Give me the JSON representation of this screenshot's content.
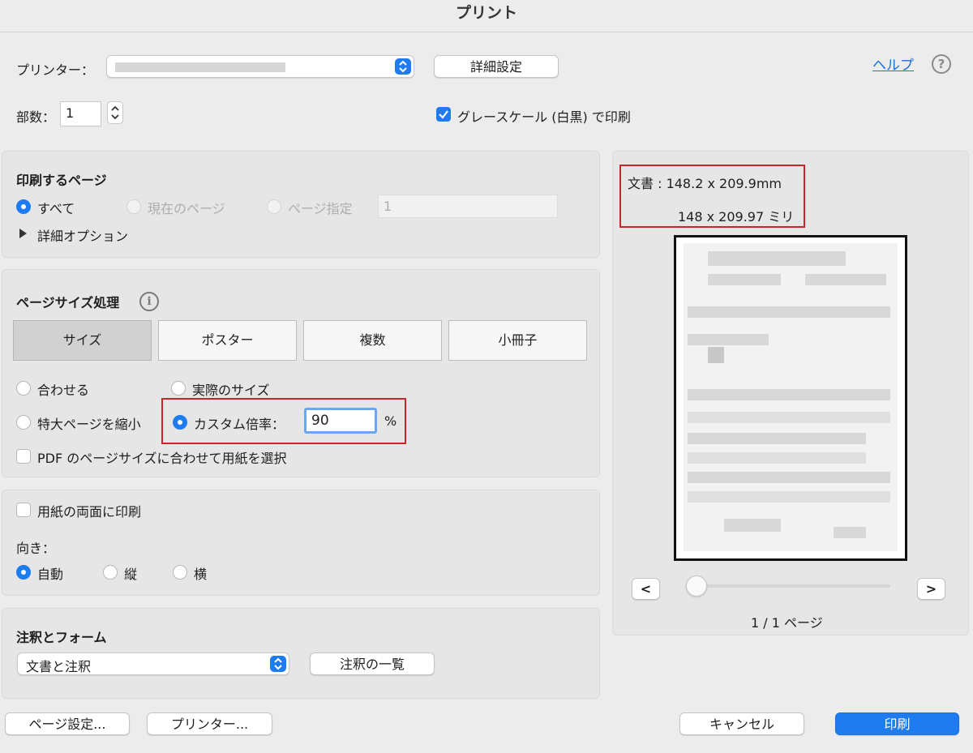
{
  "window": {
    "title": "プリント"
  },
  "printer": {
    "label": "プリンター：",
    "value": "",
    "details_button": "詳細設定",
    "help_link": "ヘルプ",
    "help_icon": "?"
  },
  "copies": {
    "label": "部数：",
    "value": "1"
  },
  "grayscale": {
    "label": "グレースケール (白黒) で印刷",
    "checked": true
  },
  "pages": {
    "title": "印刷するページ",
    "all": "すべて",
    "current": "現在のページ",
    "range": "ページ指定",
    "range_value": "1",
    "more_options": "詳細オプション"
  },
  "page_sizing": {
    "title": "ページサイズ処理",
    "info_icon": "i",
    "tabs": [
      "サイズ",
      "ポスター",
      "複数",
      "小冊子"
    ],
    "fit": "合わせる",
    "actual": "実際のサイズ",
    "shrink": "特大ページを縮小",
    "custom": "カスタム倍率：",
    "custom_value": "90",
    "percent": "%",
    "pdf_paper": "PDF のページサイズに合わせて用紙を選択"
  },
  "duplex": {
    "label": "用紙の両面に印刷",
    "orientation_label": "向き：",
    "auto": "自動",
    "portrait": "縦",
    "landscape": "横"
  },
  "comments": {
    "title": "注釈とフォーム",
    "value": "文書と注釈",
    "summary_button": "注釈の一覧"
  },
  "preview": {
    "doc_size": "文書 : 148.2 x 209.9mm",
    "paper_size": "148 x 209.97 ミリ",
    "prev": "<",
    "next": ">",
    "page_indicator": "1 / 1 ページ"
  },
  "footer": {
    "page_setup": "ページ設定...",
    "printer": "プリンター...",
    "cancel": "キャンセル",
    "print": "印刷"
  },
  "colors": {
    "accent": "#1f7cf0",
    "highlight": "#c9232b"
  }
}
